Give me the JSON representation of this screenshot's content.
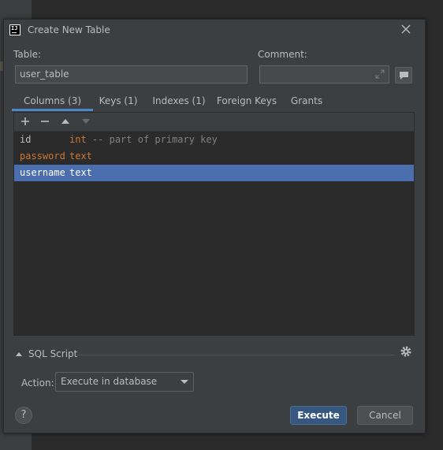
{
  "window": {
    "title": "Create New Table",
    "icon": "intellij-app-icon"
  },
  "form": {
    "table_label": "Table:",
    "table_value": "user_table",
    "comment_label": "Comment:",
    "comment_value": ""
  },
  "tabs": [
    {
      "label": "Columns (3)",
      "active": true
    },
    {
      "label": "Keys (1)",
      "active": false
    },
    {
      "label": "Indexes (1)",
      "active": false
    },
    {
      "label": "Foreign Keys",
      "active": false
    },
    {
      "label": "Grants",
      "active": false
    }
  ],
  "toolbar": {
    "icons": [
      "add-icon",
      "remove-icon",
      "move-up-icon",
      "move-down-icon"
    ]
  },
  "columns": [
    {
      "name": "id",
      "type": "int",
      "note": "-- part of primary key",
      "selected": false
    },
    {
      "name": "password",
      "type": "text",
      "note": "",
      "selected": false
    },
    {
      "name": "username",
      "type": "text",
      "note": "",
      "selected": true
    }
  ],
  "sql_section": {
    "label": "SQL Script",
    "expanded": false
  },
  "action": {
    "label": "Action:",
    "selected": "Execute in database"
  },
  "buttons": {
    "execute": "Execute",
    "cancel": "Cancel",
    "help": "?"
  },
  "colors": {
    "accent": "#4a88c7",
    "selection": "#4b6eaf",
    "keyword": "#cc7832",
    "primary_button": "#365880"
  }
}
